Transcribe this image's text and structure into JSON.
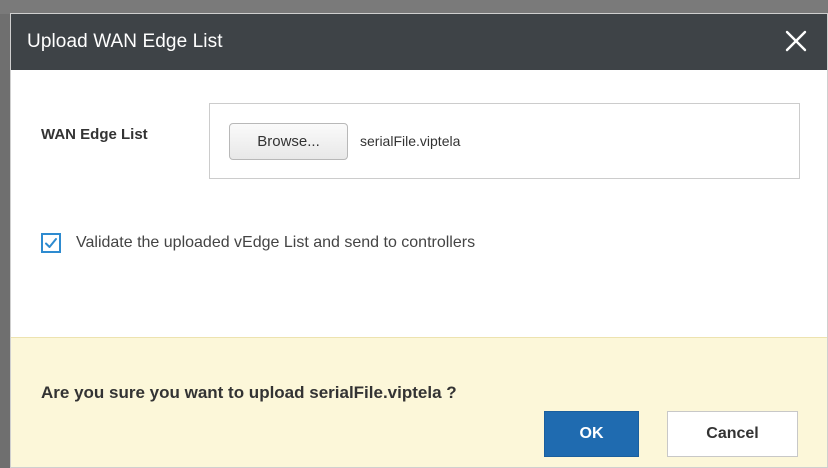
{
  "dialog": {
    "title": "Upload WAN Edge List",
    "close_icon": "close-icon"
  },
  "upload": {
    "field_label": "WAN Edge List",
    "browse_label": "Browse...",
    "selected_file": "serialFile.viptela"
  },
  "options": {
    "validate_checked": true,
    "validate_label": "Validate the uploaded vEdge List and send to controllers",
    "checkbox_icon": "checkmark-icon"
  },
  "confirm": {
    "message": "Are you sure you want to upload serialFile.viptela ?",
    "ok_label": "OK",
    "cancel_label": "Cancel"
  },
  "colors": {
    "titlebar": "#3e4347",
    "primary_button": "#1f6bb0",
    "confirm_background": "#fcf7d9",
    "checkbox_accent": "#2e8bd0"
  }
}
